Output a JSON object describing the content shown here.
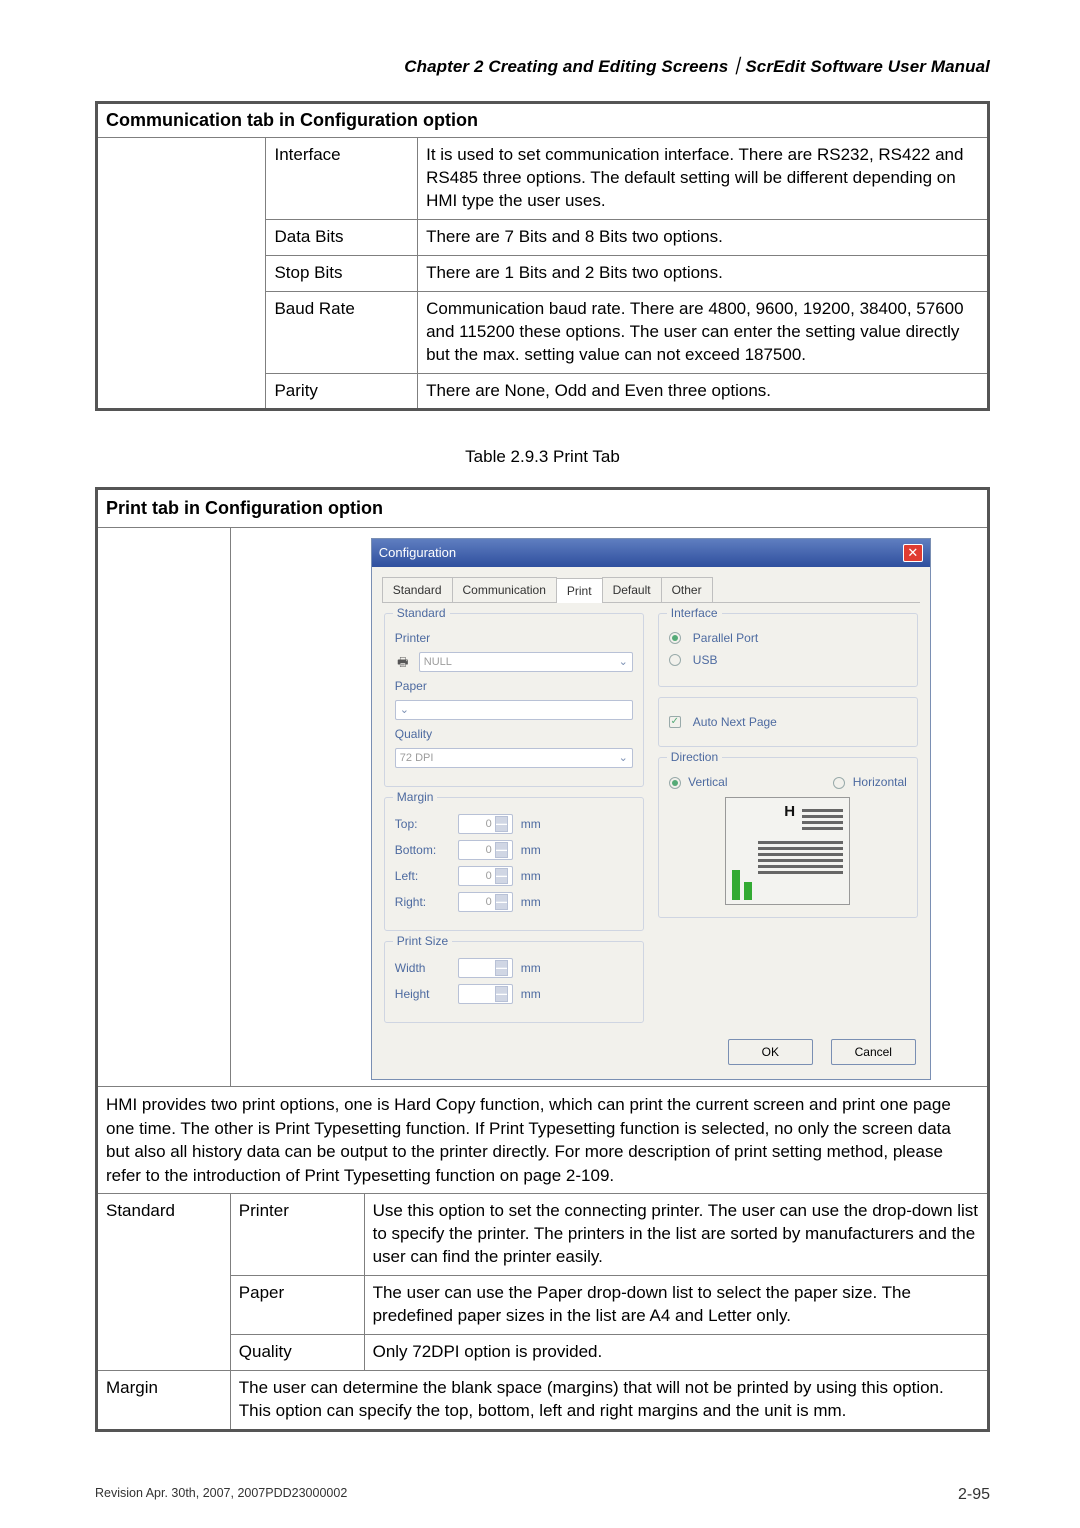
{
  "header": "Chapter 2  Creating and Editing Screens｜ScrEdit Software User Manual",
  "commTable": {
    "title": "Communication tab in Configuration option",
    "rows": [
      {
        "label": "Interface",
        "desc": "It is used to set communication interface. There are RS232, RS422 and RS485 three options. The default setting will be different depending on HMI type the user uses."
      },
      {
        "label": "Data Bits",
        "desc": "There are 7 Bits and 8 Bits two options."
      },
      {
        "label": "Stop Bits",
        "desc": "There are 1 Bits and 2 Bits two options."
      },
      {
        "label": "Baud Rate",
        "desc": "Communication baud rate. There are 4800, 9600, 19200, 38400, 57600 and 115200 these options. The user can enter the setting value directly but the max. setting value can not exceed 187500."
      },
      {
        "label": "Parity",
        "desc": "There are None, Odd and Even three options."
      }
    ]
  },
  "caption": "Table 2.9.3 Print Tab",
  "printTable": {
    "title": "Print tab in Configuration option",
    "intro": "HMI provides two print options, one is Hard Copy function, which can print the current screen and print one page one time. The other is Print Typesetting function. If Print Typesetting function is selected, no only the screen data but also all history data can be output to the printer directly. For more description of print setting method, please refer to the introduction of Print Typesetting function on page 2-109.",
    "rows": [
      {
        "cat": "Standard",
        "label": "Printer",
        "desc": "Use this option to set the connecting printer. The user can use the drop-down list to specify the printer. The printers in the list are sorted by manufacturers and the user can find the printer easily."
      },
      {
        "cat": "",
        "label": "Paper",
        "desc": "The user can use the Paper drop-down list to select the paper size. The predefined paper sizes in the list are A4 and Letter only."
      },
      {
        "cat": "",
        "label": "Quality",
        "desc": "Only 72DPI option is provided."
      },
      {
        "cat": "Margin",
        "label": "",
        "desc": "The user can determine the blank space (margins) that will not be printed by using this option. This option can specify the top, bottom, left and right margins and the unit is mm."
      }
    ]
  },
  "dialog": {
    "title": "Configuration",
    "tabs": [
      "Standard",
      "Communication",
      "Print",
      "Default",
      "Other"
    ],
    "activeTab": "Print",
    "standard": {
      "group": "Standard",
      "printerLabel": "Printer",
      "printerValue": "NULL",
      "paperLabel": "Paper",
      "qualityLabel": "Quality",
      "qualityValue": "72 DPI"
    },
    "margin": {
      "group": "Margin",
      "top": "Top:",
      "bottom": "Bottom:",
      "left": "Left:",
      "right": "Right:",
      "unit": "mm",
      "value": "0"
    },
    "printSize": {
      "group": "Print Size",
      "width": "Width",
      "height": "Height",
      "unit": "mm"
    },
    "interface": {
      "group": "Interface",
      "parallel": "Parallel Port",
      "usb": "USB"
    },
    "autoNext": "Auto Next Page",
    "direction": {
      "group": "Direction",
      "vertical": "Vertical",
      "horizontal": "Horizontal"
    },
    "ok": "OK",
    "cancel": "Cancel"
  },
  "footer": {
    "rev": "Revision Apr. 30th, 2007, 2007PDD23000002",
    "page": "2-95"
  }
}
